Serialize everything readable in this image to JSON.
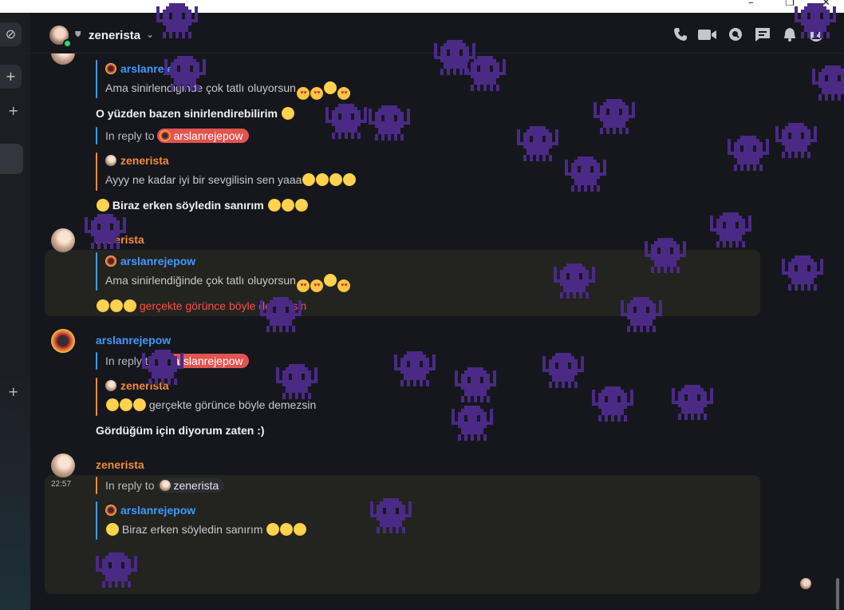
{
  "window": {
    "minimize": "–",
    "restore": "❐",
    "close": "✕"
  },
  "header": {
    "name": "zenerista"
  },
  "header_icons": [
    "phone-icon",
    "video-icon",
    "search-icon",
    "threads-icon",
    "bell-icon",
    "members-icon"
  ],
  "rail": [
    "explore-icon",
    "add-icon",
    "add-icon",
    "add-icon"
  ],
  "messages": {
    "m1": {
      "quote_author": "arslanrejepow",
      "quote_text": "Ama sinirlendiğinde çok tatlı oluyorsun",
      "line2": "O yüzden bazen sinirlendirebilirim",
      "reply_prefix": "In reply to",
      "reply_mention": "arslanrejepow",
      "quote2_author": "zenerista",
      "quote2_text": "Ayyy ne kadar iyi bir sevgilisin sen yaaa",
      "line3": "Biraz erken söyledin sanırım"
    },
    "m2": {
      "author": "zenerista",
      "quote_author": "arslanrejepow",
      "quote_text": "Ama sinirlendiğinde çok tatlı oluyorsun",
      "text": "gerçekte görünce böyle demezsin"
    },
    "m3": {
      "author": "arslanrejepow",
      "reply_prefix": "In reply to",
      "reply_mention": "arslanrejepow",
      "quote_author": "zenerista",
      "quote_text": "gerçekte görünce böyle demezsin",
      "text": "Gördüğüm için diyorum zaten :)"
    },
    "m4": {
      "author": "zenerista",
      "time": "22:57",
      "reply_prefix": "In reply to",
      "reply_mention": "zenerista",
      "quote_author": "arslanrejepow",
      "quote_text": "Biraz erken söyledin sanırım"
    }
  },
  "colors": {
    "zenerista": "#f28c3b",
    "arslanrejepow": "#3e9bff",
    "invader": "#4b2a86",
    "highlight": "#232320"
  },
  "overlay": "space-invader-icon"
}
